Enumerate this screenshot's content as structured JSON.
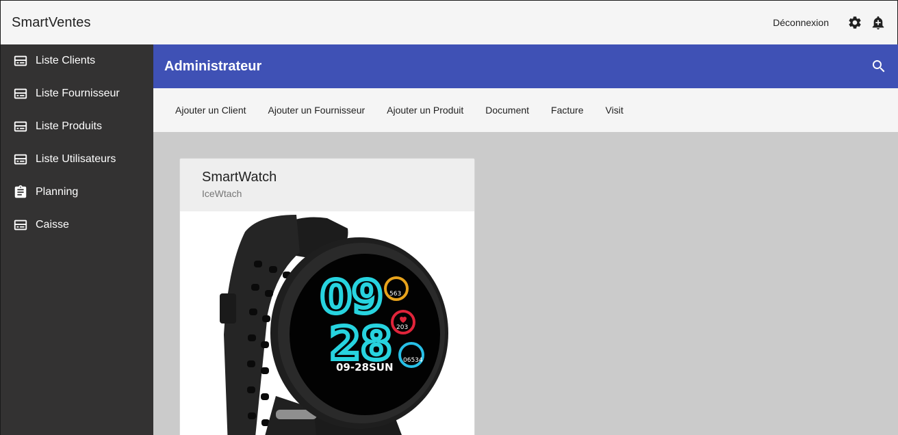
{
  "app": {
    "title": "SmartVentes"
  },
  "topbar": {
    "logout_label": "Déconnexion",
    "icons": [
      "gear-icon",
      "notification-add-icon"
    ]
  },
  "sidebar": {
    "items": [
      {
        "label": "Liste Clients",
        "icon": "list-icon"
      },
      {
        "label": "Liste Fournisseur",
        "icon": "list-icon"
      },
      {
        "label": "Liste Produits",
        "icon": "list-icon"
      },
      {
        "label": "Liste Utilisateurs",
        "icon": "list-icon"
      },
      {
        "label": "Planning",
        "icon": "clipboard-icon"
      },
      {
        "label": "Caisse",
        "icon": "list-icon"
      }
    ]
  },
  "header": {
    "title": "Administrateur",
    "search_icon": "search-icon"
  },
  "tabs": [
    {
      "label": "Ajouter un Client"
    },
    {
      "label": "Ajouter un Fournisseur"
    },
    {
      "label": "Ajouter un Produit"
    },
    {
      "label": "Document"
    },
    {
      "label": "Facture"
    },
    {
      "label": "Visit"
    }
  ],
  "product_card": {
    "title": "SmartWatch",
    "subtitle": "IceWtach",
    "watch_face": {
      "hour": "09",
      "minute": "28",
      "date": "09-28",
      "day": "SUN",
      "calories": "563",
      "heart_rate": "203",
      "steps": "06534"
    }
  },
  "colors": {
    "header": "#3f51b5",
    "sidebar": "#333232",
    "content_bg": "#cbcbcb",
    "watch_digits": "#27d3df"
  }
}
